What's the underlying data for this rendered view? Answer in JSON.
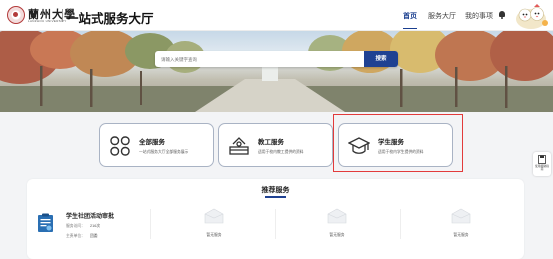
{
  "header": {
    "logo_text": "蘭州大學",
    "logo_subtext": "LANZHOU UNIVERSITY",
    "site_title": "一站式服务大厅",
    "nav": [
      {
        "label": "首页",
        "active": true
      },
      {
        "label": "服务大厅",
        "active": false
      },
      {
        "label": "我的事项",
        "active": false
      }
    ],
    "icons": {
      "notification": "bell-icon",
      "avatar": "cartoon-avatar"
    }
  },
  "banner": {
    "search_placeholder": "请输入关键字查询",
    "search_button": "搜索"
  },
  "service_cards": [
    {
      "title": "全部服务",
      "desc": "一站式服务大厅全部服务展示",
      "icon": "grid-icon"
    },
    {
      "title": "教工服务",
      "desc": "适用于校内教工提供的资料",
      "icon": "teacher-desk-icon"
    },
    {
      "title": "学生服务",
      "desc": "适用于校内学生提供的资料",
      "icon": "graduation-cap-icon",
      "highlighted": true
    }
  ],
  "float_tool": {
    "label": "使用帮助指南",
    "icon": "save-icon"
  },
  "recommend": {
    "title": "推荐服务",
    "service": {
      "name": "学生社团活动审批",
      "views_label": "服务访问：",
      "views_value": "216次",
      "dept_label": "主责单位：",
      "dept_value": "团委"
    },
    "empty_label": "暂无服务",
    "empty_slots": 3
  },
  "colors": {
    "primary": "#1f4192",
    "highlight": "#e23b3b",
    "card_border": "#a9b3c4"
  }
}
